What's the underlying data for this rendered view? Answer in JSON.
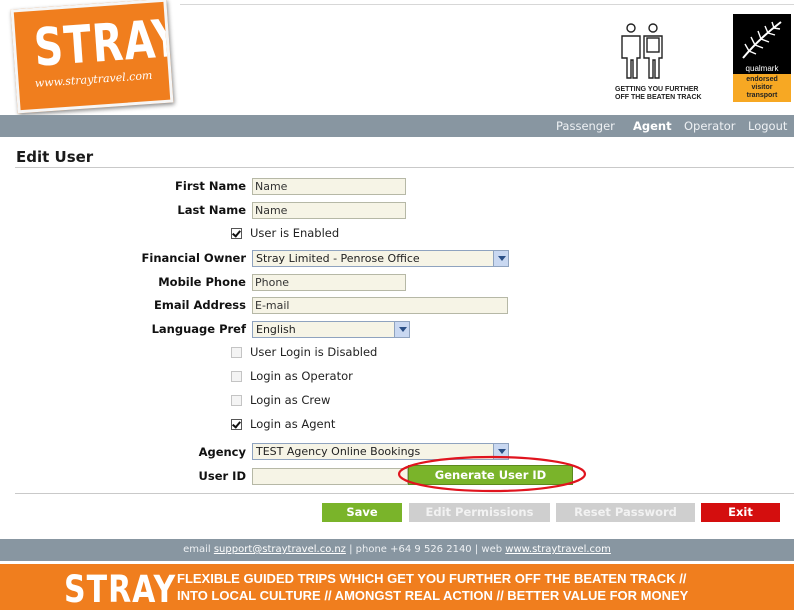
{
  "brand": {
    "logo_text": "STRAY",
    "logo_url": "www.straytravel.com",
    "tagline_line1": "GETTING YOU FURTHER",
    "tagline_line2": "OFF THE BEATEN TRACK",
    "qualmark_name": "qualmark",
    "qualmark_line1": "endorsed",
    "qualmark_line2": "visitor",
    "qualmark_line3": "transport"
  },
  "nav": {
    "items": [
      {
        "label": "Passenger",
        "active": false
      },
      {
        "label": "Agent",
        "active": true
      },
      {
        "label": "Operator",
        "active": false
      },
      {
        "label": "Logout",
        "active": false
      }
    ]
  },
  "page": {
    "title": "Edit User"
  },
  "form": {
    "first_name": {
      "label": "First Name",
      "value": "Name"
    },
    "last_name": {
      "label": "Last Name",
      "value": "Name"
    },
    "user_enabled": {
      "label": "User is Enabled",
      "checked": true
    },
    "financial_owner": {
      "label": "Financial Owner",
      "value": "Stray Limited - Penrose Office"
    },
    "mobile_phone": {
      "label": "Mobile Phone",
      "value": "Phone"
    },
    "email": {
      "label": "Email Address",
      "value": "E-mail"
    },
    "language": {
      "label": "Language Pref",
      "value": "English"
    },
    "login_disabled": {
      "label": "User Login is Disabled",
      "checked": false
    },
    "login_operator": {
      "label": "Login as Operator",
      "checked": false
    },
    "login_crew": {
      "label": "Login as Crew",
      "checked": false
    },
    "login_agent": {
      "label": "Login as Agent",
      "checked": true
    },
    "agency": {
      "label": "Agency",
      "value": "TEST Agency Online Bookings"
    },
    "user_id": {
      "label": "User ID",
      "value": ""
    },
    "generate_label": "Generate User ID"
  },
  "actions": {
    "save": "Save",
    "edit_permissions": "Edit Permissions",
    "reset_password": "Reset Password",
    "exit": "Exit"
  },
  "footer": {
    "email_prefix": "email",
    "email": "support@straytravel.co.nz",
    "phone_text": "| phone +64 9 526 2140 | web",
    "web": "www.straytravel.com",
    "logo_text": "STRAY",
    "tagline_line1": "FLEXIBLE GUIDED TRIPS WHICH GET YOU FURTHER OFF THE BEATEN TRACK //",
    "tagline_line2": "INTO LOCAL CULTURE // AMONGST REAL ACTION // BETTER VALUE FOR MONEY"
  },
  "colors": {
    "brand_orange": "#f07e1e",
    "nav_gray": "#8896a1",
    "action_green": "#7ab42a",
    "exit_red": "#d40e0e",
    "highlight_ellipse": "#e0141e"
  }
}
